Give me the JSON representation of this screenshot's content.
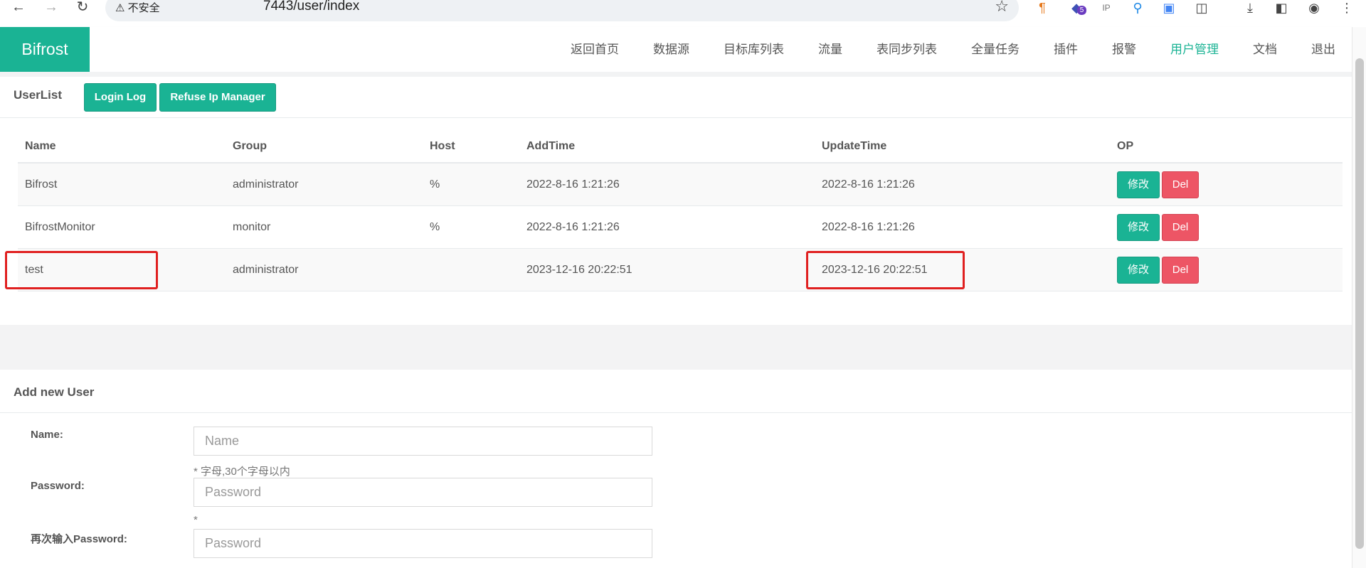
{
  "browser": {
    "security_label": "不安全",
    "url": "7443/user/index",
    "extension_icons": [
      "ext-paragraph-icon",
      "ext-5-icon",
      "ext-ip-icon",
      "ext-pin-icon",
      "ext-translate-icon",
      "extensions-puzzle-icon",
      "download-icon",
      "sidepanel-icon",
      "profile-icon",
      "menu-dots-icon"
    ],
    "badge": "5",
    "ip_label": "IP"
  },
  "header": {
    "brand": "Bifrost",
    "menu": [
      {
        "label": "返回首页"
      },
      {
        "label": "数据源"
      },
      {
        "label": "目标库列表"
      },
      {
        "label": "流量"
      },
      {
        "label": "表同步列表"
      },
      {
        "label": "全量任务"
      },
      {
        "label": "插件"
      },
      {
        "label": "报警"
      },
      {
        "label": "用户管理",
        "active": true
      },
      {
        "label": "文档"
      },
      {
        "label": "退出"
      }
    ],
    "accent_color": "#1ab394"
  },
  "userlist": {
    "title": "UserList",
    "login_log_label": "Login Log",
    "refuse_ip_label": "Refuse Ip Manager",
    "columns": [
      "Name",
      "Group",
      "Host",
      "AddTime",
      "UpdateTime",
      "OP"
    ],
    "rows": [
      {
        "name": "Bifrost",
        "group": "administrator",
        "host": "%",
        "add_time": "2022-8-16 1:21:26",
        "update_time": "2022-8-16 1:21:26",
        "edit": "修改",
        "del": "Del"
      },
      {
        "name": "BifrostMonitor",
        "group": "monitor",
        "host": "%",
        "add_time": "2022-8-16 1:21:26",
        "update_time": "2022-8-16 1:21:26",
        "edit": "修改",
        "del": "Del"
      },
      {
        "name": "test",
        "group": "administrator",
        "host": "",
        "add_time": "2023-12-16 20:22:51",
        "update_time": "2023-12-16 20:22:51",
        "edit": "修改",
        "del": "Del"
      }
    ],
    "highlight_color": "#e02020"
  },
  "add_user": {
    "title": "Add new User",
    "name_label": "Name:",
    "name_placeholder": "Name",
    "name_help": "* 字母,30个字母以内",
    "password_label": "Password:",
    "password_placeholder": "Password",
    "password_help": "*",
    "password2_label": "再次输入Password:",
    "password2_placeholder": "Password"
  }
}
